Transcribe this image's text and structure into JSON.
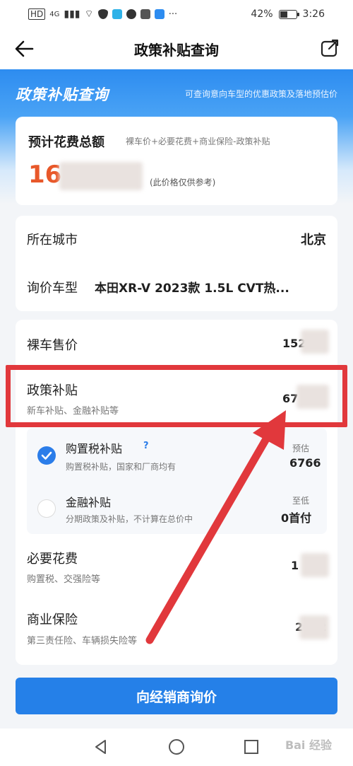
{
  "status_bar": {
    "network": "4G",
    "battery": "42%",
    "time": "3:26",
    "more": "···"
  },
  "navbar": {
    "title": "政策补贴查询"
  },
  "hero": {
    "logo_text": "政策补贴查询",
    "description": "可查询意向车型的优惠政策及落地预估价"
  },
  "total": {
    "title": "预计花费总额",
    "formula": "裸车价+必要花费+商业保险-政策补贴",
    "value_visible": "16",
    "note": "(此价格仅供参考)"
  },
  "city": {
    "label": "所在城市",
    "value": "北京"
  },
  "model": {
    "label": "询价车型",
    "value": "本田XR-V 2023款 1.5L CVT热..."
  },
  "price": {
    "label": "裸车售价",
    "value_visible": "152"
  },
  "subsidy": {
    "label": "政策补贴",
    "sub": "新车补贴、金融补贴等",
    "value_visible": "67"
  },
  "tax_subsidy": {
    "label": "购置税补贴",
    "help": "?",
    "sub": "购置税补贴，国家和厂商均有",
    "price_prefix": "预估",
    "price": "6766",
    "checked": true
  },
  "finance_subsidy": {
    "label": "金融补贴",
    "sub": "分期政策及补贴，不计算在总价中",
    "price_prefix": "至低",
    "price": "0首付",
    "checked": false
  },
  "necessary": {
    "label": "必要花费",
    "sub": "购置税、交强险等",
    "value_visible": "1"
  },
  "insurance": {
    "label": "商业保险",
    "sub": "第三责任险、车辆损失险等",
    "value_visible": "2052"
  },
  "cta": {
    "label": "向经销商询价"
  },
  "watermark": "Bai 经验",
  "colors": {
    "primary": "#2580e8",
    "total_price": "#e8582a",
    "annotation_red": "#e1383c"
  }
}
